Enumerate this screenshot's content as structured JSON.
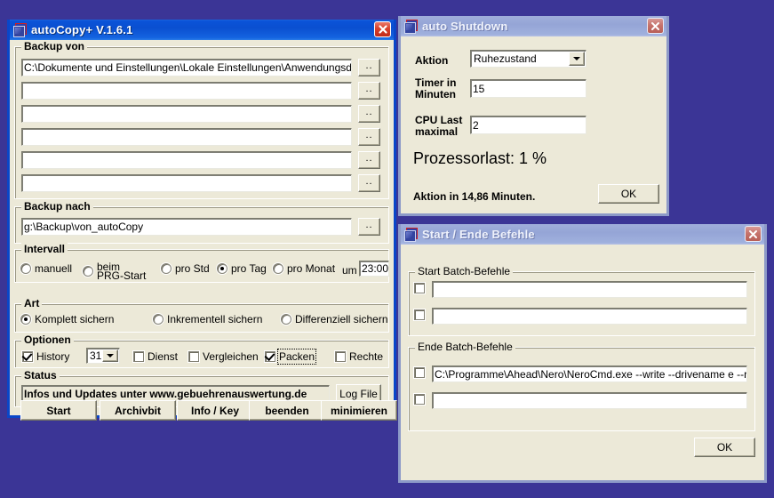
{
  "desktop": {
    "background": "#3b3596"
  },
  "windows": {
    "autocopy": {
      "title": "autoCopy+  V.1.6.1",
      "groups": {
        "backup_von": "Backup von",
        "backup_nach": "Backup nach",
        "intervall": "Intervall",
        "art": "Art",
        "optionen": "Optionen",
        "status": "Status"
      },
      "backup_von_paths": [
        "C:\\Dokumente und Einstellungen\\Lokale Einstellungen\\Anwendungsdaten",
        "",
        "",
        "",
        "",
        ""
      ],
      "browse_label": "..",
      "backup_nach_path": "g:\\Backup\\von_autoCopy",
      "intervall": {
        "options": [
          {
            "label": "manuell",
            "selected": false
          },
          {
            "label": "beim\nPRG-Start",
            "line1": "beim",
            "line2": "PRG-Start",
            "selected": false
          },
          {
            "label": "pro Std",
            "selected": false
          },
          {
            "label": "pro Tag",
            "selected": true
          },
          {
            "label": "pro Monat",
            "selected": false
          }
        ],
        "um_label": "um",
        "um_time": "23:00"
      },
      "art": {
        "options": [
          {
            "label": "Komplett sichern",
            "selected": true
          },
          {
            "label": "Inkrementell sichern",
            "selected": false
          },
          {
            "label": "Differenziell sichern",
            "selected": false
          }
        ]
      },
      "optionen": {
        "history_label": "History",
        "history_checked": true,
        "history_value": "31",
        "checks": [
          {
            "label": "Dienst",
            "checked": false,
            "focused": false
          },
          {
            "label": "Vergleichen",
            "checked": false,
            "focused": false
          },
          {
            "label": "Packen",
            "checked": true,
            "focused": true
          },
          {
            "label": "Rechte",
            "checked": false,
            "focused": false
          }
        ]
      },
      "status": {
        "text": "Infos  und  Updates  unter  www.gebuehrenauswertung.de",
        "logfile_button": "Log File"
      },
      "buttons": [
        "Start",
        "Archivbit",
        "Info / Key",
        "beenden",
        "minimieren"
      ]
    },
    "shutdown": {
      "title": "auto Shutdown",
      "aktion_label": "Aktion",
      "aktion_value": "Ruhezustand",
      "timer_label_line1": "Timer in",
      "timer_label_line2": "Minuten",
      "timer_value": "15",
      "cpu_label_line1": "CPU Last",
      "cpu_label_line2": "maximal",
      "cpu_value": "2",
      "prozessorlast": "Prozessorlast:  1 %",
      "aktion_in": "Aktion in 14,86  Minuten.",
      "ok_button": "OK"
    },
    "commands": {
      "title": "Start / Ende Befehle",
      "start_group": "Start Batch-Befehle",
      "start_rows": [
        {
          "checked": false,
          "value": ""
        },
        {
          "checked": false,
          "value": ""
        }
      ],
      "end_group": "Ende Batch-Befehle",
      "end_rows": [
        {
          "checked": false,
          "value": "C:\\Programme\\Ahead\\Nero\\NeroCmd.exe --write --drivename e --real --spe"
        },
        {
          "checked": false,
          "value": ""
        }
      ],
      "ok_button": "OK"
    }
  }
}
